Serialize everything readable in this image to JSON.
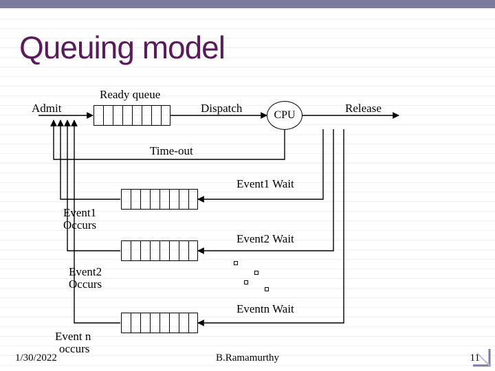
{
  "title": "Queuing model",
  "labels": {
    "ready_queue": "Ready queue",
    "admit": "Admit",
    "dispatch": "Dispatch",
    "cpu": "CPU",
    "release": "Release",
    "timeout": "Time-out",
    "event1_wait": "Event1 Wait",
    "event1_occurs_l1": "Event1",
    "event1_occurs_l2": "Occurs",
    "event2_wait": "Event2 Wait",
    "event2_occurs_l1": "Event2",
    "event2_occurs_l2": "Occurs",
    "eventn_wait": "Eventn Wait",
    "eventn_occurs_l1": "Event n",
    "eventn_occurs_l2": "occurs"
  },
  "footer": {
    "date": "1/30/2022",
    "author": "B.Ramamurthy",
    "page": "11"
  },
  "queues": {
    "slots": 8
  }
}
